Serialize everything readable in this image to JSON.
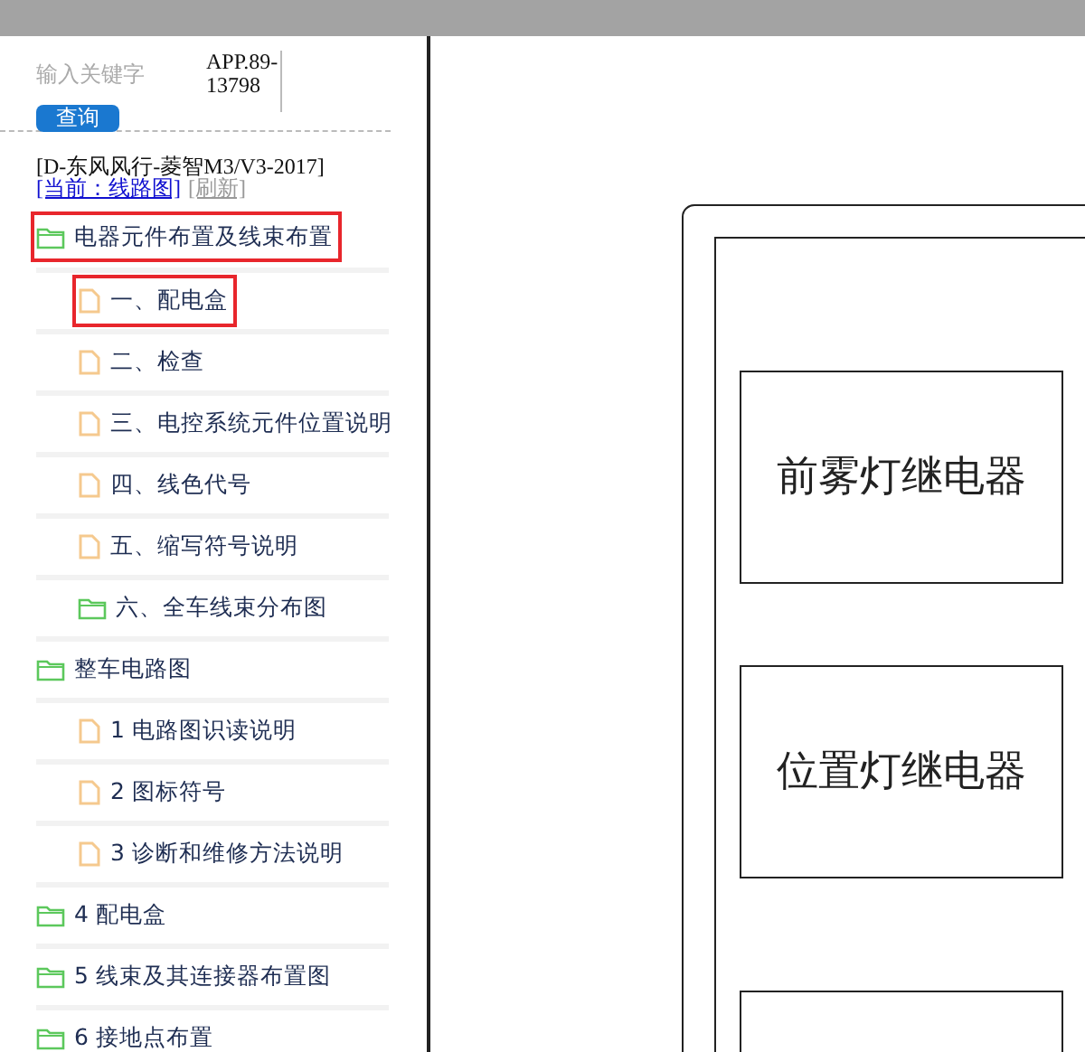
{
  "search": {
    "placeholder": "输入关键字",
    "button": "查询"
  },
  "app_id": "APP.89-13798",
  "vehicle": "[D-东风风行-菱智M3/V3-2017]",
  "current_link": "[当前：线路图]",
  "refresh_link": "[刷新]",
  "tree": [
    {
      "label": "电器元件布置及线束布置",
      "kind": "folder",
      "highlighted": true,
      "children": [
        {
          "label": "一、配电盒",
          "kind": "file",
          "highlighted": true
        },
        {
          "label": "二、检查",
          "kind": "file",
          "highlighted": false
        },
        {
          "label": "三、电控系统元件位置说明",
          "kind": "file",
          "highlighted": false
        },
        {
          "label": "四、线色代号",
          "kind": "file",
          "highlighted": false
        },
        {
          "label": "五、缩写符号说明",
          "kind": "file",
          "highlighted": false
        },
        {
          "label": "六、全车线束分布图",
          "kind": "folder",
          "highlighted": false
        }
      ]
    },
    {
      "label": "整车电路图",
      "kind": "folder",
      "highlighted": false,
      "children": [
        {
          "label": "1 电路图识读说明",
          "kind": "file",
          "highlighted": false
        },
        {
          "label": "2 图标符号",
          "kind": "file",
          "highlighted": false
        },
        {
          "label": "3 诊断和维修方法说明",
          "kind": "file",
          "highlighted": false
        }
      ]
    },
    {
      "label": "4 配电盒",
      "kind": "folder",
      "highlighted": false
    },
    {
      "label": "5 线束及其连接器布置图",
      "kind": "folder",
      "highlighted": false
    },
    {
      "label": "6 接地点布置",
      "kind": "folder",
      "highlighted": false
    }
  ],
  "diagram": {
    "relays": [
      "前雾灯继电器",
      "位置灯继电器"
    ]
  }
}
